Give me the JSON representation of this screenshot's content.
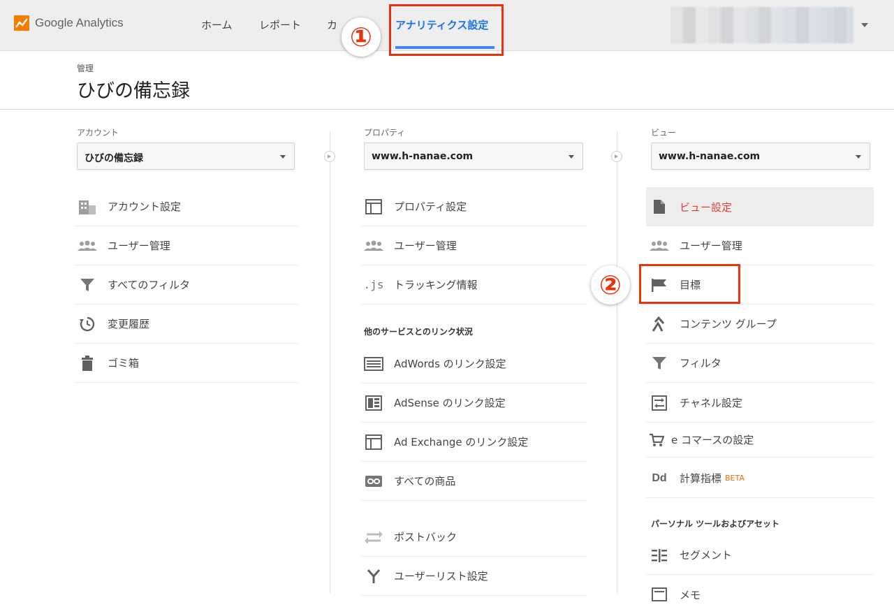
{
  "app": {
    "name": "Google Analytics"
  },
  "nav": {
    "home": "ホーム",
    "reports": "レポート",
    "customize": "カ",
    "admin": "アナリティクス設定"
  },
  "annotations": {
    "one": "①",
    "two": "②"
  },
  "header": {
    "breadcrumb": "管理",
    "title": "ひびの備忘録"
  },
  "account": {
    "label": "アカウント",
    "selected": "ひびの備忘録",
    "items": [
      {
        "icon": "building-icon",
        "label": "アカウント設定"
      },
      {
        "icon": "users-icon",
        "label": "ユーザー管理"
      },
      {
        "icon": "filter-icon",
        "label": "すべてのフィルタ"
      },
      {
        "icon": "history-icon",
        "label": "変更履歴"
      },
      {
        "icon": "trash-icon",
        "label": "ゴミ箱"
      }
    ]
  },
  "property": {
    "label": "プロパティ",
    "selected": "www.h-nanae.com",
    "items": [
      {
        "icon": "property-layout-icon",
        "label": "プロパティ設定"
      },
      {
        "icon": "users-icon",
        "label": "ユーザー管理"
      },
      {
        "icon": "js-icon",
        "label": "トラッキング情報"
      }
    ],
    "link_section": "他のサービスとのリンク状況",
    "link_items": [
      {
        "icon": "adwords-icon",
        "label": "AdWords のリンク設定"
      },
      {
        "icon": "adsense-icon",
        "label": "AdSense のリンク設定"
      },
      {
        "icon": "adexchange-icon",
        "label": "Ad Exchange のリンク設定"
      },
      {
        "icon": "link-icon",
        "label": "すべての商品"
      },
      {
        "icon": "postback-icon",
        "label": "ポストバック"
      },
      {
        "icon": "audience-icon",
        "label": "ユーザーリスト設定"
      }
    ]
  },
  "view": {
    "label": "ビュー",
    "selected": "www.h-nanae.com",
    "items": [
      {
        "icon": "document-icon",
        "label": "ビュー設定"
      },
      {
        "icon": "users-icon",
        "label": "ユーザー管理"
      },
      {
        "icon": "flag-icon",
        "label": "目標"
      },
      {
        "icon": "content-group-icon",
        "label": "コンテンツ グループ"
      },
      {
        "icon": "filter-icon",
        "label": "フィルタ"
      },
      {
        "icon": "channel-icon",
        "label": "チャネル設定"
      },
      {
        "icon": "cart-icon",
        "label": "e コマースの設定"
      },
      {
        "icon": "dd-icon",
        "label": "計算指標",
        "badge": "BETA"
      }
    ],
    "personal_section": "パーソナル ツールおよびアセット",
    "personal_items": [
      {
        "icon": "segment-icon",
        "label": "セグメント"
      },
      {
        "icon": "note-icon",
        "label": "メモ"
      }
    ]
  },
  "colors": {
    "accent": "#1a73e8",
    "highlight": "#e8340e",
    "selected_text": "#e53935",
    "topbar": "#eeeeee"
  }
}
